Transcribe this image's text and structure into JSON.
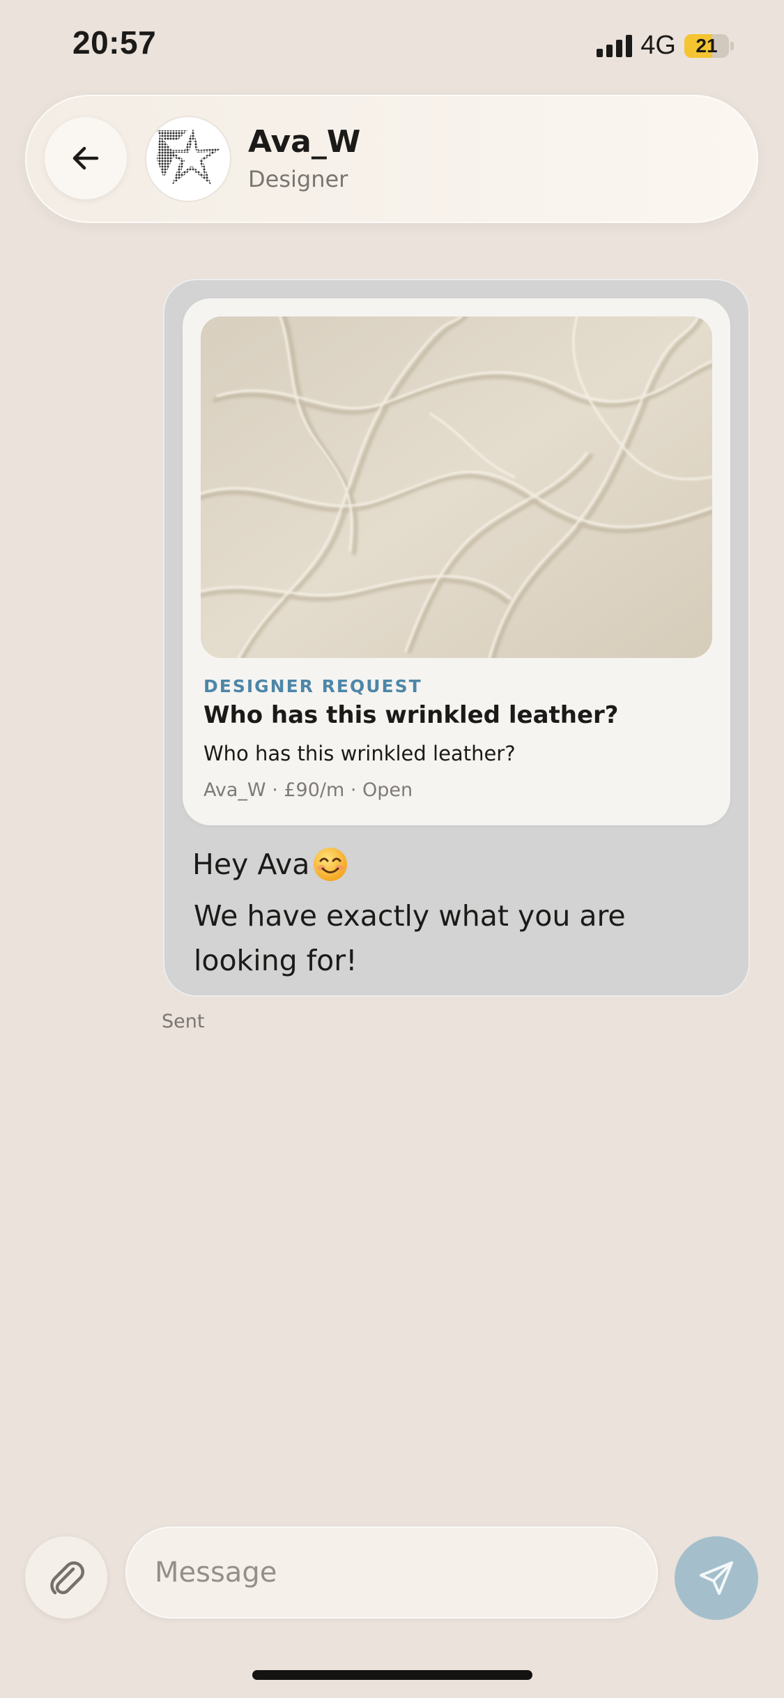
{
  "status_bar": {
    "time": "20:57",
    "network": "4G",
    "battery_level": "21",
    "battery_fraction": 0.21,
    "battery_color": "#f5c531"
  },
  "header": {
    "back_icon": "arrow-left-icon",
    "avatar_icon": "star-logo",
    "name": "Ava_W",
    "role": "Designer"
  },
  "message": {
    "card": {
      "image_icon": "wrinkled-leather-photo",
      "tag": "DESIGNER REQUEST",
      "title": "Who has this wrinkled leather?",
      "description": "Who has this wrinkled leather?",
      "meta": "Ava_W · £90/m · Open",
      "tag_color": "#4d86a8"
    },
    "line1": "Hey Ava",
    "emoji": "smiling-face-emoji",
    "line2": "We have exactly what you are looking for!",
    "status": "Sent"
  },
  "composer": {
    "attach_icon": "paperclip-icon",
    "placeholder": "Message",
    "send_icon": "send-icon",
    "send_color": "#a4bfcb"
  }
}
